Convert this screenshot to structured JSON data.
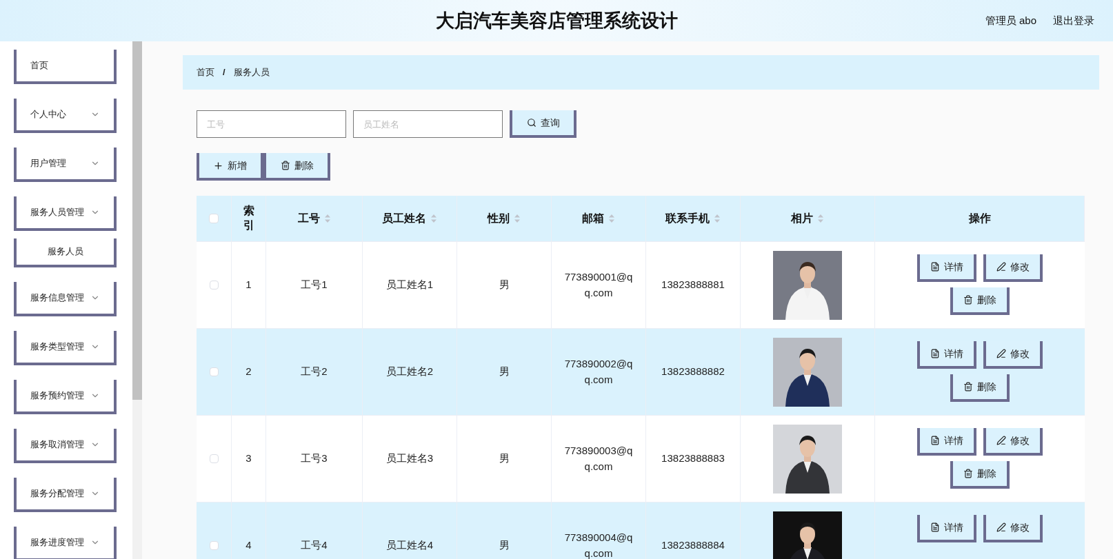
{
  "header": {
    "title": "大启汽车美容店管理系统设计",
    "user": "管理员 abo",
    "logout": "退出登录"
  },
  "sidebar": {
    "items": [
      {
        "label": "首页",
        "expandable": false
      },
      {
        "label": "个人中心",
        "expandable": true
      },
      {
        "label": "用户管理",
        "expandable": true
      },
      {
        "label": "服务人员管理",
        "expandable": true,
        "children": [
          {
            "label": "服务人员"
          }
        ]
      },
      {
        "label": "服务信息管理",
        "expandable": true
      },
      {
        "label": "服务类型管理",
        "expandable": true
      },
      {
        "label": "服务预约管理",
        "expandable": true
      },
      {
        "label": "服务取消管理",
        "expandable": true
      },
      {
        "label": "服务分配管理",
        "expandable": true
      },
      {
        "label": "服务进度管理",
        "expandable": true
      }
    ]
  },
  "breadcrumb": [
    "首页",
    "服务人员"
  ],
  "breadcrumb_separator": "/",
  "search": {
    "fields": [
      {
        "placeholder": "工号"
      },
      {
        "placeholder": "员工姓名"
      }
    ],
    "button": "查询"
  },
  "toolbar": [
    {
      "kind": "add",
      "label": "新增"
    },
    {
      "kind": "delete",
      "label": "删除"
    }
  ],
  "table": {
    "select_all_checked": false,
    "columns": [
      {
        "kind": "check",
        "sortable": false
      },
      {
        "label": "索引",
        "sortable": false
      },
      {
        "label": "工号",
        "sortable": true
      },
      {
        "label": "员工姓名",
        "sortable": true
      },
      {
        "label": "性别",
        "sortable": true
      },
      {
        "label": "邮箱",
        "sortable": true
      },
      {
        "label": "联系手机",
        "sortable": true
      },
      {
        "label": "相片",
        "sortable": true
      },
      {
        "label": "操作",
        "sortable": false
      }
    ],
    "rows": [
      {
        "checked": false,
        "index": "1",
        "id": "工号1",
        "name": "员工姓名1",
        "gender": "男",
        "email": "773890001@qq.com",
        "phone": "13823888881",
        "photo": {
          "kind": "picture"
        },
        "actions": [
          {
            "kind": "detail",
            "label": "详情"
          },
          {
            "kind": "edit",
            "label": "修改"
          },
          {
            "kind": "delete",
            "label": "删除"
          }
        ]
      },
      {
        "checked": false,
        "index": "2",
        "id": "工号2",
        "name": "员工姓名2",
        "gender": "男",
        "email": "773890002@qq.com",
        "phone": "13823888882",
        "photo": {
          "kind": "picture"
        },
        "actions": [
          {
            "kind": "detail",
            "label": "详情"
          },
          {
            "kind": "edit",
            "label": "修改"
          },
          {
            "kind": "delete",
            "label": "删除"
          }
        ]
      },
      {
        "checked": false,
        "index": "3",
        "id": "工号3",
        "name": "员工姓名3",
        "gender": "男",
        "email": "773890003@qq.com",
        "phone": "13823888883",
        "photo": {
          "kind": "picture"
        },
        "actions": [
          {
            "kind": "detail",
            "label": "详情"
          },
          {
            "kind": "edit",
            "label": "修改"
          },
          {
            "kind": "delete",
            "label": "删除"
          }
        ]
      },
      {
        "checked": false,
        "index": "4",
        "id": "工号4",
        "name": "员工姓名4",
        "gender": "男",
        "email": "773890004@qq.com",
        "phone": "13823888884",
        "photo": {
          "kind": "picture"
        },
        "actions": [
          {
            "kind": "detail",
            "label": "详情"
          },
          {
            "kind": "edit",
            "label": "修改"
          }
        ]
      }
    ]
  }
}
